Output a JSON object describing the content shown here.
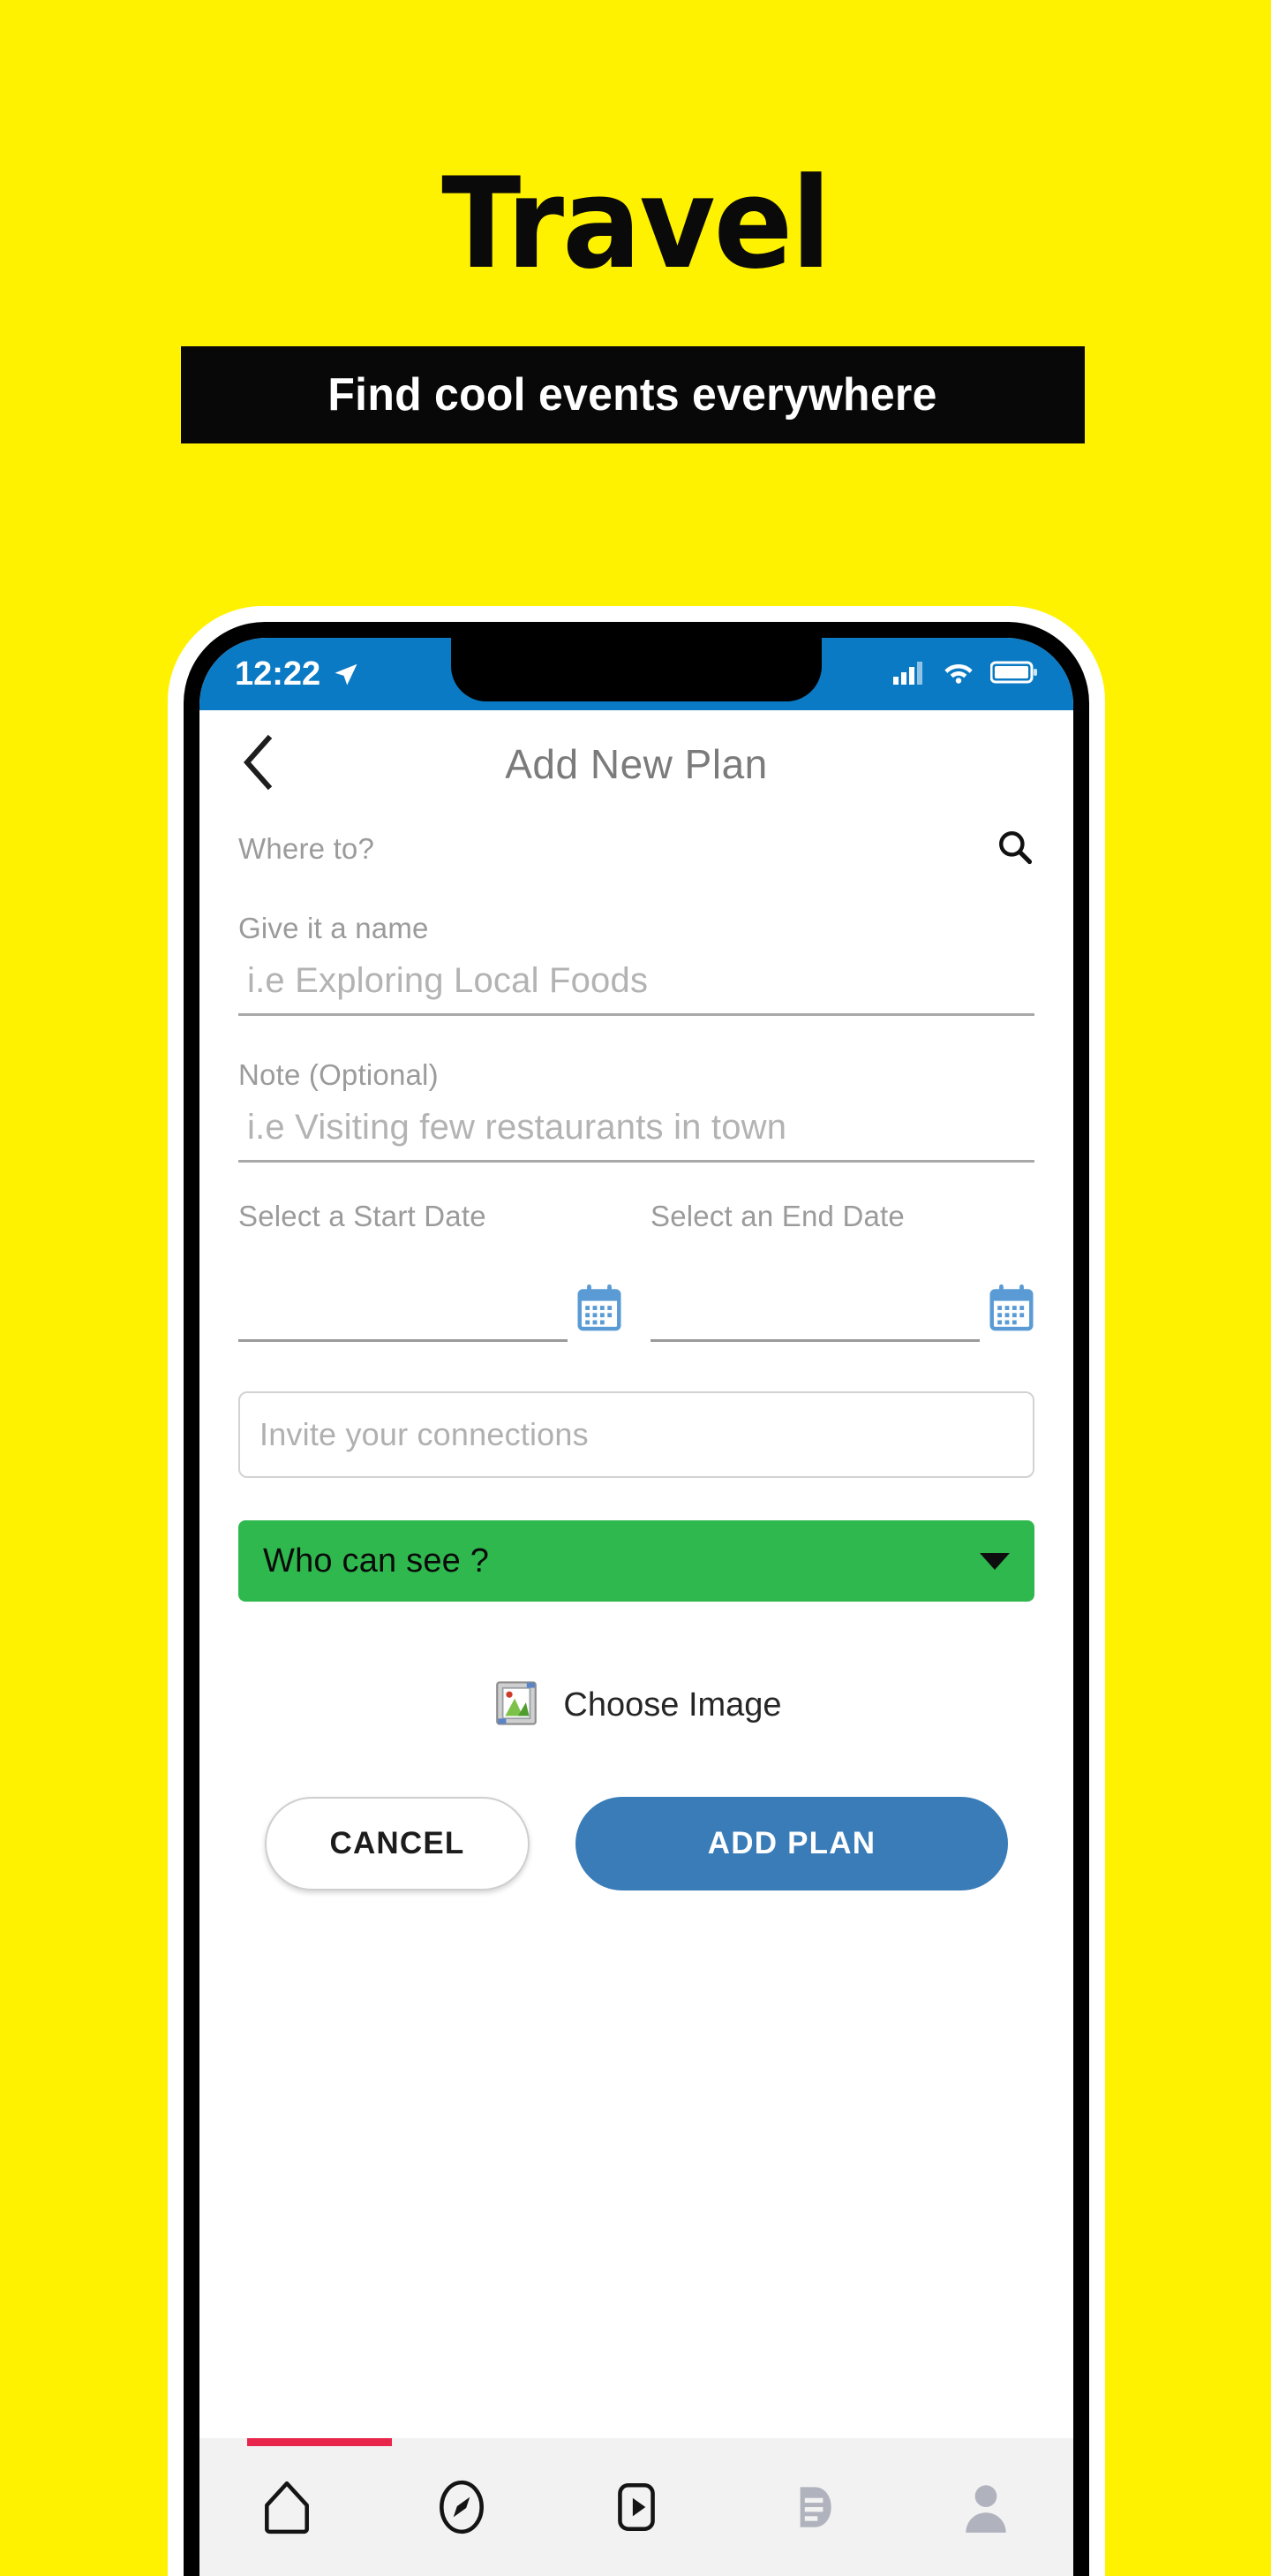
{
  "promo": {
    "title": "Travel",
    "banner_text": "Find cool events everywhere",
    "background_color": "#FFF200",
    "banner_color": "#080808",
    "banner_text_color": "#FFFFFF"
  },
  "phone": {
    "status_bar": {
      "time": "12:22",
      "location_icon": "location-arrow-icon",
      "signal_icon": "cellular-signal-icon",
      "wifi_icon": "wifi-icon",
      "battery_icon": "battery-full-icon",
      "background_color": "#0B7AC4"
    },
    "app": {
      "header": {
        "back_icon": "back-chevron-icon",
        "title": "Add New Plan"
      },
      "where_to": {
        "label": "Where to?",
        "search_icon": "search-icon"
      },
      "name_field": {
        "label": "Give it a name",
        "placeholder": "i.e Exploring Local Foods",
        "value": ""
      },
      "note_field": {
        "label": "Note (Optional)",
        "placeholder": "i.e Visiting few restaurants in town",
        "value": ""
      },
      "start_date": {
        "label": "Select a Start Date",
        "value": "",
        "calendar_icon": "calendar-icon"
      },
      "end_date": {
        "label": "Select an End Date",
        "value": "",
        "calendar_icon": "calendar-icon"
      },
      "invite_field": {
        "placeholder": "Invite your connections",
        "value": ""
      },
      "visibility_dropdown": {
        "label": "Who can see ?",
        "color": "#2FB84D",
        "caret_icon": "chevron-down-icon"
      },
      "choose_image": {
        "label": "Choose Image",
        "icon": "picture-icon"
      },
      "buttons": {
        "cancel": "CANCEL",
        "add_plan": "ADD PLAN",
        "add_plan_color": "#3A7CB8"
      },
      "bottom_nav": {
        "indicator_color": "#E8254B",
        "items": [
          {
            "name": "home-icon",
            "active": true
          },
          {
            "name": "compass-icon",
            "active": true
          },
          {
            "name": "video-play-icon",
            "active": true
          },
          {
            "name": "feed-list-icon",
            "active": false
          },
          {
            "name": "profile-person-icon",
            "active": false
          }
        ]
      }
    }
  }
}
